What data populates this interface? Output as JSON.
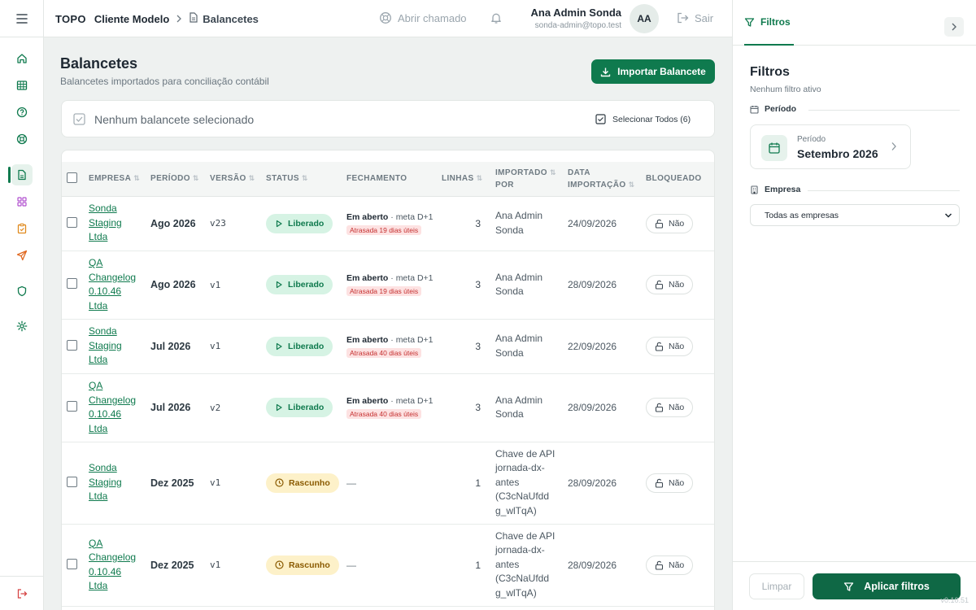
{
  "sidebar": {
    "icons": [
      "menu-icon",
      "home-icon",
      "table-icon",
      "help-icon",
      "support-icon",
      "document-icon",
      "grid-icon",
      "clipboard-icon",
      "send-icon",
      "shield-icon",
      "settings-icon",
      "logout-icon"
    ],
    "active_color": "#0f7a4e"
  },
  "header": {
    "org": "TOPO",
    "client": "Cliente Modelo",
    "page": "Balancetes",
    "open_ticket": "Abrir chamado",
    "user_name": "Ana Admin Sonda",
    "user_email": "sonda-admin@topo.test",
    "avatar_initials": "AA",
    "logout": "Sair"
  },
  "main": {
    "title": "Balancetes",
    "subtitle": "Balancetes importados para conciliação contábil",
    "import_button": "Importar Balancete",
    "selection_text": "Nenhum balancete selecionado",
    "select_all": "Selecionar Todos (6)"
  },
  "table": {
    "headers": {
      "empresa": "EMPRESA",
      "periodo": "PERÍODO",
      "versao": "VERSÃO",
      "status": "STATUS",
      "fechamento": "FECHAMENTO",
      "linhas": "LINHAS",
      "importado_1": "IMPORTADO",
      "importado_2": "POR",
      "data_1": "DATA",
      "data_2": "IMPORTAÇÃO",
      "bloqueado": "BLOQUEADO"
    },
    "rows": [
      {
        "empresa": [
          "Sonda",
          "Staging",
          "Ltda"
        ],
        "periodo": "Ago 2026",
        "versao": "v23",
        "status": "Liberado",
        "fech_status": "Em aberto",
        "fech_meta": " · meta D+1",
        "fech_late": "Atrasada 19 dias úteis",
        "linhas": "3",
        "importado": [
          "Ana Admin",
          "Sonda"
        ],
        "data": "24/09/2026",
        "bloqueado": "Não"
      },
      {
        "empresa": [
          "QA",
          "Changelog",
          "0.10.46",
          "Ltda"
        ],
        "periodo": "Ago 2026",
        "versao": "v1",
        "status": "Liberado",
        "fech_status": "Em aberto",
        "fech_meta": " · meta D+1",
        "fech_late": "Atrasada 19 dias úteis",
        "linhas": "3",
        "importado": [
          "Ana Admin",
          "Sonda"
        ],
        "data": "28/09/2026",
        "bloqueado": "Não"
      },
      {
        "empresa": [
          "Sonda",
          "Staging",
          "Ltda"
        ],
        "periodo": "Jul 2026",
        "versao": "v1",
        "status": "Liberado",
        "fech_status": "Em aberto",
        "fech_meta": " · meta D+1",
        "fech_late": "Atrasada 40 dias úteis",
        "linhas": "3",
        "importado": [
          "Ana Admin",
          "Sonda"
        ],
        "data": "22/09/2026",
        "bloqueado": "Não"
      },
      {
        "empresa": [
          "QA",
          "Changelog",
          "0.10.46",
          "Ltda"
        ],
        "periodo": "Jul 2026",
        "versao": "v2",
        "status": "Liberado",
        "fech_status": "Em aberto",
        "fech_meta": " · meta D+1",
        "fech_late": "Atrasada 40 dias úteis",
        "linhas": "3",
        "importado": [
          "Ana Admin",
          "Sonda"
        ],
        "data": "28/09/2026",
        "bloqueado": "Não"
      },
      {
        "empresa": [
          "Sonda",
          "Staging",
          "Ltda"
        ],
        "periodo": "Dez 2025",
        "versao": "v1",
        "status": "Rascunho",
        "fech_dash": "—",
        "linhas": "1",
        "importado": [
          "Chave de API",
          "jornada-dx-",
          "antes",
          "(C3cNaUfdd",
          "g_wlTqA)"
        ],
        "data": "28/09/2026",
        "bloqueado": "Não"
      },
      {
        "empresa": [
          "QA",
          "Changelog",
          "0.10.46",
          "Ltda"
        ],
        "periodo": "Dez 2025",
        "versao": "v1",
        "status": "Rascunho",
        "fech_dash": "—",
        "linhas": "1",
        "importado": [
          "Chave de API",
          "jornada-dx-",
          "antes",
          "(C3cNaUfdd",
          "g_wlTqA)"
        ],
        "data": "28/09/2026",
        "bloqueado": "Não"
      }
    ]
  },
  "filters": {
    "tab": "Filtros",
    "title": "Filtros",
    "subtitle": "Nenhum filtro ativo",
    "period_label": "Período",
    "period_card_label": "Período",
    "period_value": "Setembro 2026",
    "company_label": "Empresa",
    "company_value": "Todas as empresas",
    "clear": "Limpar",
    "apply": "Aplicar filtros",
    "version": "v0.10.51"
  }
}
